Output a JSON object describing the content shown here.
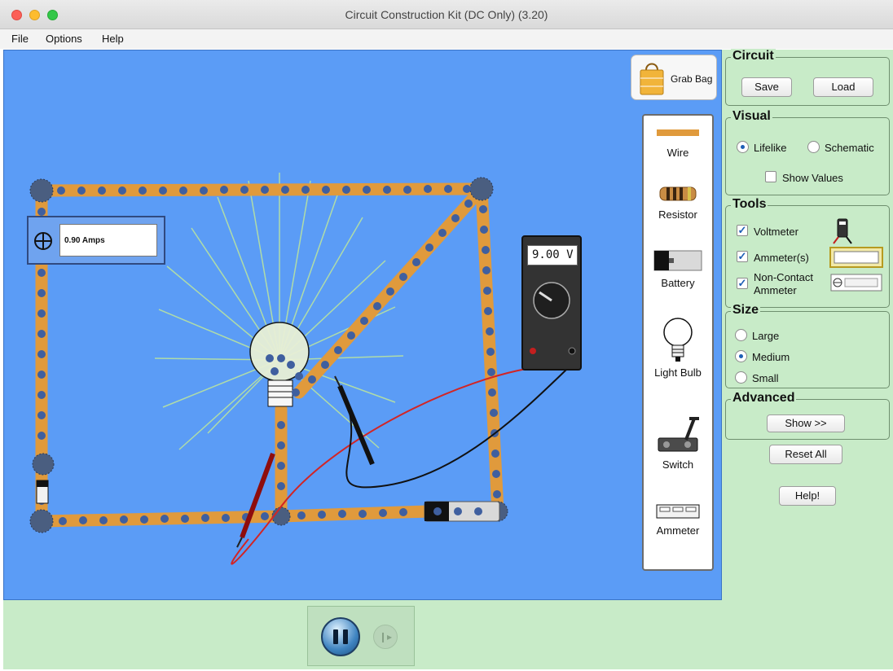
{
  "window": {
    "title": "Circuit Construction Kit (DC Only) (3.20)"
  },
  "menu": [
    {
      "label": "File"
    },
    {
      "label": "Options"
    },
    {
      "label": "Help"
    }
  ],
  "grab_bag": {
    "label": "Grab Bag"
  },
  "toolbox": {
    "items": [
      {
        "label": "Wire"
      },
      {
        "label": "Resistor"
      },
      {
        "label": "Battery"
      },
      {
        "label": "Light Bulb"
      },
      {
        "label": "Switch"
      },
      {
        "label": "Ammeter"
      }
    ]
  },
  "ammeter_readout": {
    "value": "0.90 Amps"
  },
  "voltmeter": {
    "reading": "9.00 V"
  },
  "panel": {
    "circuit": {
      "title": "Circuit",
      "save_label": "Save",
      "load_label": "Load"
    },
    "visual": {
      "title": "Visual",
      "lifelike_label": "Lifelike",
      "schematic_label": "Schematic",
      "show_values_label": "Show Values",
      "selected": "Lifelike",
      "show_values": false
    },
    "tools": {
      "title": "Tools",
      "voltmeter_label": "Voltmeter",
      "ammeters_label": "Ammeter(s)",
      "noncontact_line1": "Non-Contact",
      "noncontact_line2": "Ammeter",
      "voltmeter_checked": true,
      "ammeters_checked": true,
      "noncontact_checked": true
    },
    "size": {
      "title": "Size",
      "large_label": "Large",
      "medium_label": "Medium",
      "small_label": "Small",
      "selected": "Medium"
    },
    "advanced": {
      "title": "Advanced",
      "show_label": "Show >>"
    },
    "reset_label": "Reset All",
    "help_label": "Help!"
  },
  "colors": {
    "canvas_bg": "#5b9cf6",
    "panel_bg": "#c8ebc8",
    "wire": "#e09a3c",
    "electron": "#3f5f9f"
  },
  "icons": {
    "pause": "pause-icon",
    "step": "step-icon",
    "crosshair": "crosshair-icon"
  }
}
